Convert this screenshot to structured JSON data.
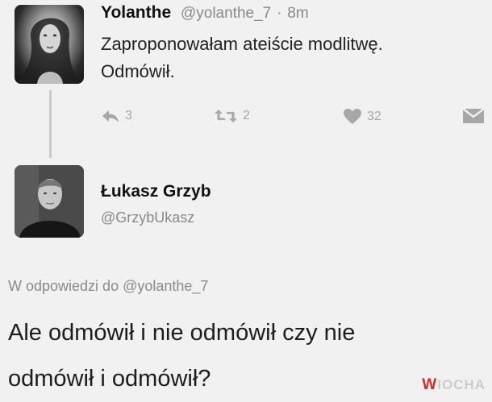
{
  "tweet": {
    "author_name": "Yolanthe",
    "author_handle": "@yolanthe_7",
    "separator": "·",
    "time": "8m",
    "text_line1": "Zaproponowałam ateiście modlitwę.",
    "text_line2": "Odmówił.",
    "actions": {
      "reply_count": "3",
      "retweet_count": "2",
      "like_count": "32"
    },
    "avatar_icon": "profile-photo"
  },
  "reply": {
    "author_name": "Łukasz Grzyb",
    "author_handle": "@GrzybUkasz",
    "context_prefix": "W odpowiedzi do",
    "context_mention": "@yolanthe_7",
    "text_line1": "Ale odmówił i nie odmówił czy nie",
    "text_line2": "odmówił i odmówił?",
    "avatar_icon": "profile-photo"
  },
  "watermark": {
    "first_letter": "W",
    "rest": "IOCHA"
  },
  "colors": {
    "background": "#f1f1f1",
    "muted": "#8a8a8a",
    "icon": "#a7a7a7",
    "watermark_accent": "#d32b2b"
  }
}
